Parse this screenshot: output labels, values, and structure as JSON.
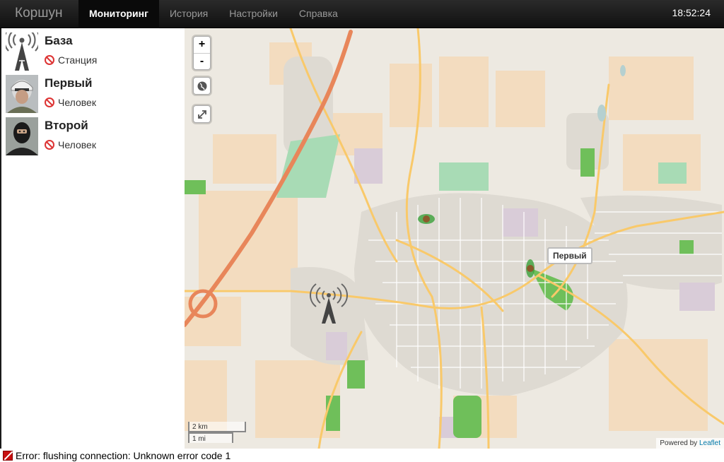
{
  "app": {
    "brand": "Коршун",
    "nav": [
      {
        "label": "Мониторинг",
        "active": true
      },
      {
        "label": "История",
        "active": false
      },
      {
        "label": "Настройки",
        "active": false
      },
      {
        "label": "Справка",
        "active": false
      }
    ],
    "clock": "18:52:24"
  },
  "objects": [
    {
      "name": "База",
      "status": "Станция",
      "icon": "antenna-tower-icon"
    },
    {
      "name": "Первый",
      "status": "Человек",
      "icon": "person-helmet-avatar"
    },
    {
      "name": "Второй",
      "status": "Человек",
      "icon": "person-balaclava-avatar"
    }
  ],
  "map": {
    "zoom_in": "+",
    "zoom_out": "-",
    "marker_label": "Первый",
    "scale_km": "2 km",
    "scale_mi": "1 mi",
    "attribution_prefix": "Powered by",
    "attribution_link": "Leaflet"
  },
  "statusbar": {
    "message": "Error: flushing connection: Unknown error code 1"
  },
  "colors": {
    "navbar": "#1b1b1b",
    "status_error": "#c81010",
    "map_background": "#ede9e1",
    "road_major": "#f9c96a",
    "highway": "#e8865a",
    "park": "#6fbf5a"
  }
}
